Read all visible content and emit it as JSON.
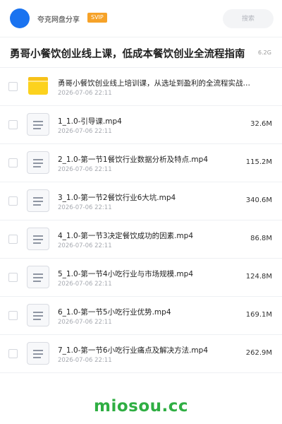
{
  "header": {
    "owner_name": "夸克网盘分享",
    "badge": "SVIP",
    "search_placeholder": "搜索",
    "colors": {
      "avatar": "#1a73f0",
      "badge": "#f6a228"
    }
  },
  "title": {
    "text": "勇哥小餐饮创业线上课，低成本餐饮创业全流程指南",
    "total_size": "6.2G"
  },
  "items": [
    {
      "type": "folder",
      "icon": "folder-icon",
      "name": "勇哥小餐饮创业线上培训课，从选址到盈利的全流程实战…",
      "date": "2026-07-06 22:11",
      "size": ""
    },
    {
      "type": "video",
      "icon": "file-icon",
      "name": "1_1.0-引导课.mp4",
      "date": "2026-07-06 22:11",
      "size": "32.6M"
    },
    {
      "type": "video",
      "icon": "file-icon",
      "name": "2_1.0-第一节1餐饮行业数据分析及特点.mp4",
      "date": "2026-07-06 22:11",
      "size": "115.2M"
    },
    {
      "type": "video",
      "icon": "file-icon",
      "name": "3_1.0-第一节2餐饮行业6大坑.mp4",
      "date": "2026-07-06 22:11",
      "size": "340.6M"
    },
    {
      "type": "video",
      "icon": "file-icon",
      "name": "4_1.0-第一节3决定餐饮成功的因素.mp4",
      "date": "2026-07-06 22:11",
      "size": "86.8M"
    },
    {
      "type": "video",
      "icon": "file-icon",
      "name": "5_1.0-第一节4小吃行业与市场规模.mp4",
      "date": "2026-07-06 22:11",
      "size": "124.8M"
    },
    {
      "type": "video",
      "icon": "file-icon",
      "name": "6_1.0-第一节5小吃行业优势.mp4",
      "date": "2026-07-06 22:11",
      "size": "169.1M"
    },
    {
      "type": "video",
      "icon": "file-icon",
      "name": "7_1.0-第一节6小吃行业痛点及解决方法.mp4",
      "date": "2026-07-06 22:11",
      "size": "262.9M"
    }
  ],
  "watermark": "miosou.cc"
}
